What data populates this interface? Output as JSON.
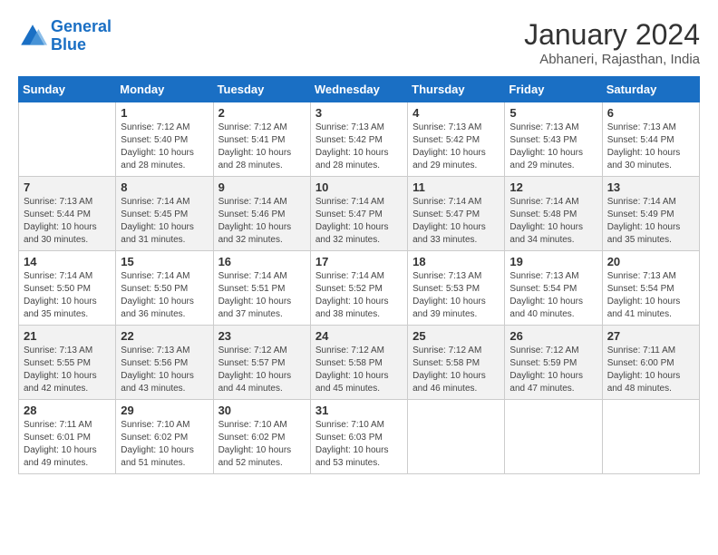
{
  "header": {
    "logo_general": "General",
    "logo_blue": "Blue",
    "title": "January 2024",
    "location": "Abhaneri, Rajasthan, India"
  },
  "calendar": {
    "headers": [
      "Sunday",
      "Monday",
      "Tuesday",
      "Wednesday",
      "Thursday",
      "Friday",
      "Saturday"
    ],
    "weeks": [
      [
        {
          "day": "",
          "info": ""
        },
        {
          "day": "1",
          "info": "Sunrise: 7:12 AM\nSunset: 5:40 PM\nDaylight: 10 hours\nand 28 minutes."
        },
        {
          "day": "2",
          "info": "Sunrise: 7:12 AM\nSunset: 5:41 PM\nDaylight: 10 hours\nand 28 minutes."
        },
        {
          "day": "3",
          "info": "Sunrise: 7:13 AM\nSunset: 5:42 PM\nDaylight: 10 hours\nand 28 minutes."
        },
        {
          "day": "4",
          "info": "Sunrise: 7:13 AM\nSunset: 5:42 PM\nDaylight: 10 hours\nand 29 minutes."
        },
        {
          "day": "5",
          "info": "Sunrise: 7:13 AM\nSunset: 5:43 PM\nDaylight: 10 hours\nand 29 minutes."
        },
        {
          "day": "6",
          "info": "Sunrise: 7:13 AM\nSunset: 5:44 PM\nDaylight: 10 hours\nand 30 minutes."
        }
      ],
      [
        {
          "day": "7",
          "info": "Sunrise: 7:13 AM\nSunset: 5:44 PM\nDaylight: 10 hours\nand 30 minutes."
        },
        {
          "day": "8",
          "info": "Sunrise: 7:14 AM\nSunset: 5:45 PM\nDaylight: 10 hours\nand 31 minutes."
        },
        {
          "day": "9",
          "info": "Sunrise: 7:14 AM\nSunset: 5:46 PM\nDaylight: 10 hours\nand 32 minutes."
        },
        {
          "day": "10",
          "info": "Sunrise: 7:14 AM\nSunset: 5:47 PM\nDaylight: 10 hours\nand 32 minutes."
        },
        {
          "day": "11",
          "info": "Sunrise: 7:14 AM\nSunset: 5:47 PM\nDaylight: 10 hours\nand 33 minutes."
        },
        {
          "day": "12",
          "info": "Sunrise: 7:14 AM\nSunset: 5:48 PM\nDaylight: 10 hours\nand 34 minutes."
        },
        {
          "day": "13",
          "info": "Sunrise: 7:14 AM\nSunset: 5:49 PM\nDaylight: 10 hours\nand 35 minutes."
        }
      ],
      [
        {
          "day": "14",
          "info": "Sunrise: 7:14 AM\nSunset: 5:50 PM\nDaylight: 10 hours\nand 35 minutes."
        },
        {
          "day": "15",
          "info": "Sunrise: 7:14 AM\nSunset: 5:50 PM\nDaylight: 10 hours\nand 36 minutes."
        },
        {
          "day": "16",
          "info": "Sunrise: 7:14 AM\nSunset: 5:51 PM\nDaylight: 10 hours\nand 37 minutes."
        },
        {
          "day": "17",
          "info": "Sunrise: 7:14 AM\nSunset: 5:52 PM\nDaylight: 10 hours\nand 38 minutes."
        },
        {
          "day": "18",
          "info": "Sunrise: 7:13 AM\nSunset: 5:53 PM\nDaylight: 10 hours\nand 39 minutes."
        },
        {
          "day": "19",
          "info": "Sunrise: 7:13 AM\nSunset: 5:54 PM\nDaylight: 10 hours\nand 40 minutes."
        },
        {
          "day": "20",
          "info": "Sunrise: 7:13 AM\nSunset: 5:54 PM\nDaylight: 10 hours\nand 41 minutes."
        }
      ],
      [
        {
          "day": "21",
          "info": "Sunrise: 7:13 AM\nSunset: 5:55 PM\nDaylight: 10 hours\nand 42 minutes."
        },
        {
          "day": "22",
          "info": "Sunrise: 7:13 AM\nSunset: 5:56 PM\nDaylight: 10 hours\nand 43 minutes."
        },
        {
          "day": "23",
          "info": "Sunrise: 7:12 AM\nSunset: 5:57 PM\nDaylight: 10 hours\nand 44 minutes."
        },
        {
          "day": "24",
          "info": "Sunrise: 7:12 AM\nSunset: 5:58 PM\nDaylight: 10 hours\nand 45 minutes."
        },
        {
          "day": "25",
          "info": "Sunrise: 7:12 AM\nSunset: 5:58 PM\nDaylight: 10 hours\nand 46 minutes."
        },
        {
          "day": "26",
          "info": "Sunrise: 7:12 AM\nSunset: 5:59 PM\nDaylight: 10 hours\nand 47 minutes."
        },
        {
          "day": "27",
          "info": "Sunrise: 7:11 AM\nSunset: 6:00 PM\nDaylight: 10 hours\nand 48 minutes."
        }
      ],
      [
        {
          "day": "28",
          "info": "Sunrise: 7:11 AM\nSunset: 6:01 PM\nDaylight: 10 hours\nand 49 minutes."
        },
        {
          "day": "29",
          "info": "Sunrise: 7:10 AM\nSunset: 6:02 PM\nDaylight: 10 hours\nand 51 minutes."
        },
        {
          "day": "30",
          "info": "Sunrise: 7:10 AM\nSunset: 6:02 PM\nDaylight: 10 hours\nand 52 minutes."
        },
        {
          "day": "31",
          "info": "Sunrise: 7:10 AM\nSunset: 6:03 PM\nDaylight: 10 hours\nand 53 minutes."
        },
        {
          "day": "",
          "info": ""
        },
        {
          "day": "",
          "info": ""
        },
        {
          "day": "",
          "info": ""
        }
      ]
    ]
  }
}
